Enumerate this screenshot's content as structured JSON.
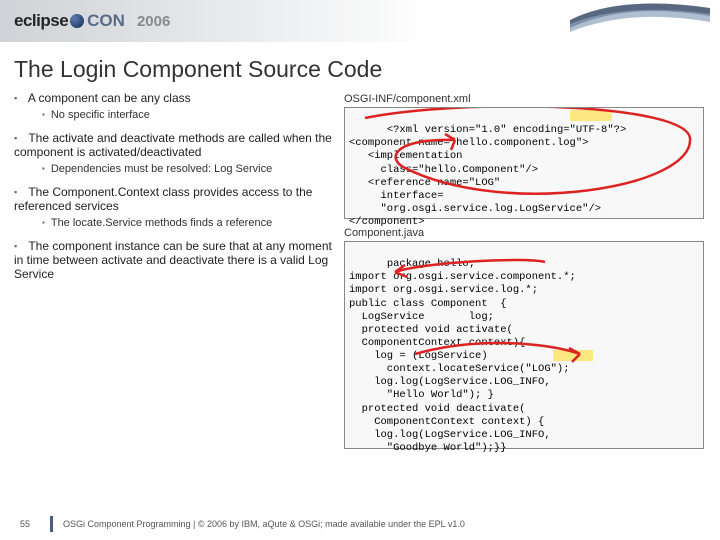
{
  "header": {
    "brand_left": "eclipse",
    "brand_right": "CON",
    "year": "2006"
  },
  "title": "The Login Component Source Code",
  "bullets": [
    {
      "text": "A component can be any class",
      "sub": [
        "No specific interface"
      ]
    },
    {
      "text": "The activate and deactivate methods are called when the component is activated/deactivated",
      "sub": [
        "Dependencies must be resolved: Log Service"
      ]
    },
    {
      "text": "The Component.Context class provides access to the referenced services",
      "sub": [
        "The locate.Service methods finds a reference"
      ]
    },
    {
      "text": "The component instance can be sure that at any moment in time between activate and deactivate there is a valid Log Service",
      "sub": []
    }
  ],
  "code": {
    "xml_label": "OSGI-INF/component.xml",
    "xml": "<?xml version=\"1.0\" encoding=\"UTF-8\"?>\n<component name=\"hello.component.log\">\n   <implementation\n     class=\"hello.Component\"/>\n   <reference name=\"LOG\"\n     interface=\n     \"org.osgi.service.log.LogService\"/>\n</component>",
    "java_label": "Component.java",
    "java": "package hello;\nimport org.osgi.service.component.*;\nimport org.osgi.service.log.*;\npublic class Component  {\n  LogService       log;\n  protected void activate(\n  ComponentContext context){\n    log = (LogService)\n      context.locateService(\"LOG\");\n    log.log(LogService.LOG_INFO,\n      \"Hello World\"); }\n  protected void deactivate(\n    ComponentContext context) {\n    log.log(LogService.LOG_INFO,\n      \"Goodbye World\");}}"
  },
  "footer": {
    "page": "55",
    "text": "OSGi Component Programming | © 2006 by IBM, aQute & OSGi; made available under the EPL v1.0"
  },
  "colors": {
    "annotation": "#d22",
    "highlight": "#ffe25a"
  }
}
